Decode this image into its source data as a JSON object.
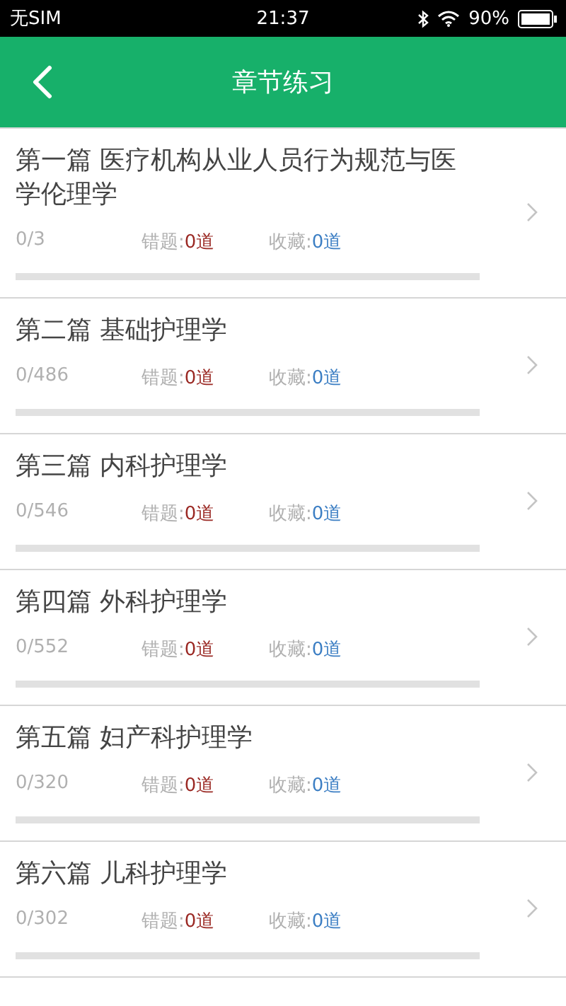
{
  "status_bar": {
    "carrier": "无SIM",
    "time": "21:37",
    "battery": "90%"
  },
  "header": {
    "title": "章节练习"
  },
  "chapters": [
    {
      "title": "第一篇 医疗机构从业人员行为规范与医学伦理学",
      "progress": "0/3",
      "level": 0,
      "wrong_label": "错题:",
      "wrong": "0道",
      "fav_label": "收藏:",
      "fav": "0道"
    },
    {
      "title": "第二篇 基础护理学",
      "progress": "0/486",
      "level": 0,
      "wrong_label": "错题:",
      "wrong": "0道",
      "fav_label": "收藏:",
      "fav": "0道"
    },
    {
      "title": "第三篇 内科护理学",
      "progress": "0/546",
      "level": 0,
      "wrong_label": "错题:",
      "wrong": "0道",
      "fav_label": "收藏:",
      "fav": "0道"
    },
    {
      "title": "第四篇 外科护理学",
      "progress": "0/552",
      "level": 0,
      "wrong_label": "错题:",
      "wrong": "0道",
      "fav_label": "收藏:",
      "fav": "0道"
    },
    {
      "title": "第五篇 妇产科护理学",
      "progress": "0/320",
      "level": 0,
      "wrong_label": "错题:",
      "wrong": "0道",
      "fav_label": "收藏:",
      "fav": "0道"
    },
    {
      "title": "第六篇 儿科护理学",
      "progress": "0/302",
      "level": 0,
      "wrong_label": "错题:",
      "wrong": "0道",
      "fav_label": "收藏:",
      "fav": "0道"
    }
  ]
}
